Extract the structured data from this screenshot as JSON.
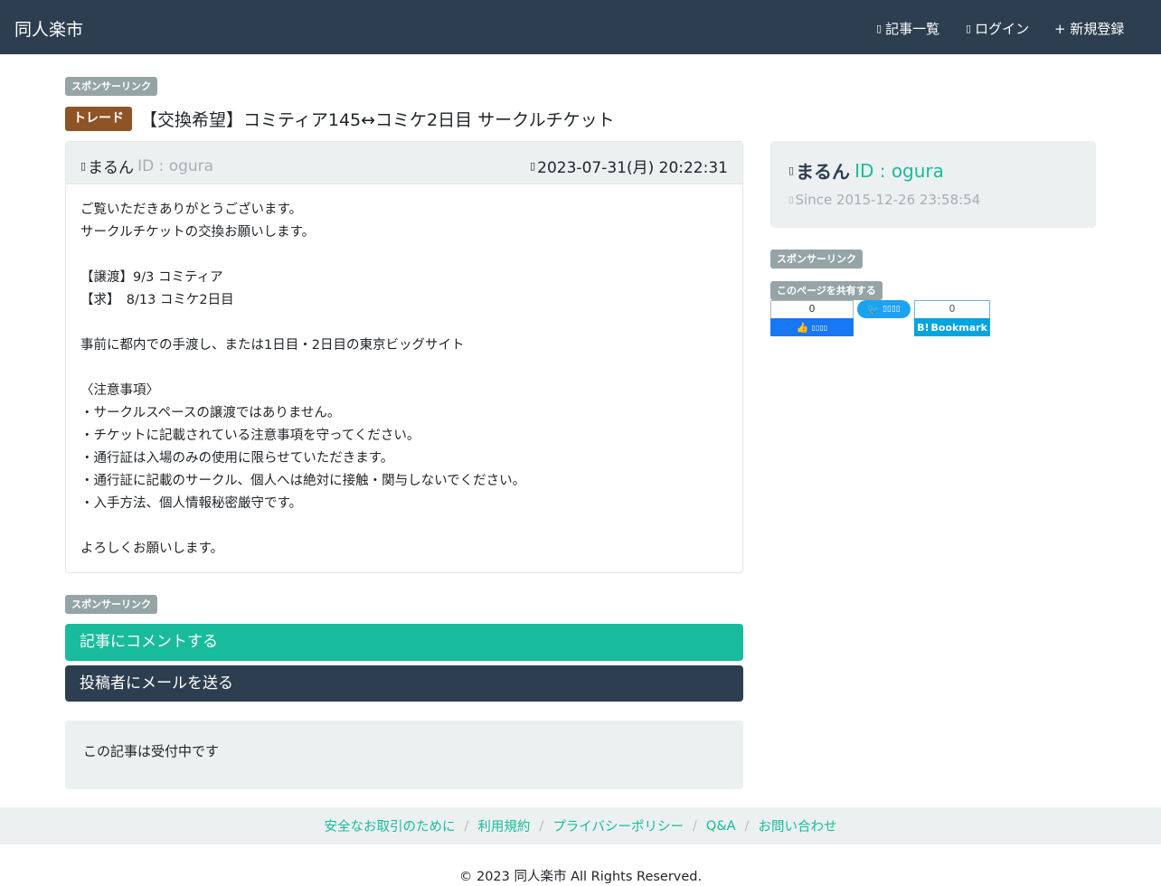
{
  "navbar": {
    "brand": "同人楽市",
    "list_label": "記事一覧",
    "login_label": "ログイン",
    "register_label": "+ 新規登録"
  },
  "sponsor_label": "スポンサーリンク",
  "post": {
    "category": "トレード",
    "title": "【交換希望】コミティア145↔コミケ2日目 サークルチケット",
    "author_name": "まるん",
    "author_id": "ID : ogura",
    "datetime": "2023-07-31(月) 20:22:31",
    "body_lines": [
      "ご覧いただきありがとうございます。",
      "サークルチケットの交換お願いします。",
      "",
      "【譲渡】9/3 コミティア",
      "【求】　8/13 コミケ2日目",
      "",
      "事前に都内での手渡し、または1日目・2日目の東京ビッグサイト",
      "",
      "〈注意事項〉",
      "・サークルスペースの譲渡ではありません。",
      "・チケットに記載されている注意事項を守ってください。",
      "・通行証は入場のみの使用に限らせていただきます。",
      "・通行証に記載のサークル、個人へは絶対に接触・関与しないでください。",
      "・入手方法、個人情報秘密厳守です。",
      "",
      "よろしくお願いします。"
    ]
  },
  "buttons": {
    "comment": "記事にコメントする",
    "mail": "投稿者にメールを送る"
  },
  "status_text": "この記事は受付中です",
  "sidebar": {
    "profile_name": "まるん",
    "profile_id": "ID : ogura",
    "since": "Since 2015-12-26 23:58:54",
    "sponsor_label": "スポンサーリンク",
    "share_label": "このページを共有する",
    "facebook_count": "0",
    "hatena_count": "0",
    "hatena_label": "Bookmark"
  },
  "footer": {
    "links": [
      "安全なお取引のために",
      "利用規約",
      "プライバシーポリシー",
      "Q&A",
      "お問い合わせ"
    ],
    "copyright": "© 2023 同人楽市 All Rights Reserved."
  }
}
